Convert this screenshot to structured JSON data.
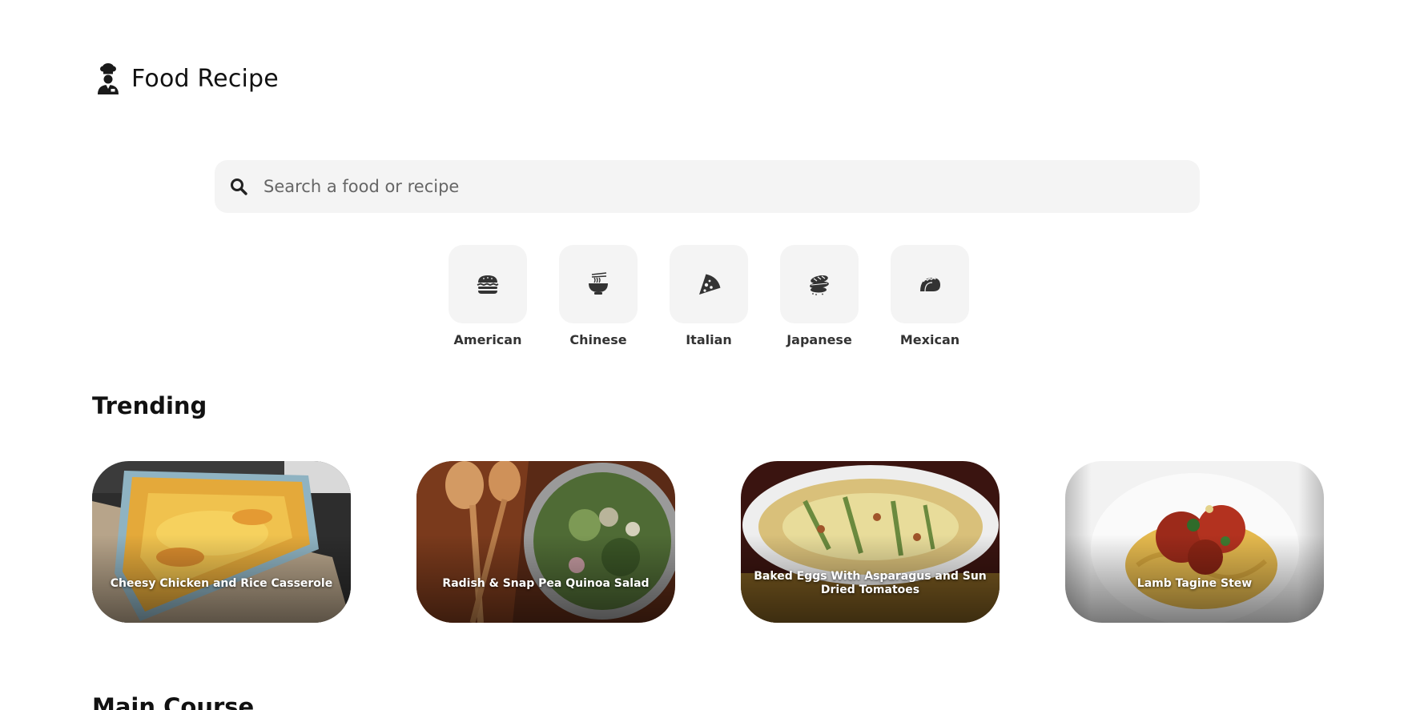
{
  "app": {
    "title": "Food Recipe",
    "logo_icon": "chef-icon"
  },
  "search": {
    "placeholder": "Search a food or recipe",
    "value": "",
    "icon": "search-icon"
  },
  "cuisines": [
    {
      "label": "American",
      "icon": "burger-icon"
    },
    {
      "label": "Chinese",
      "icon": "noodle-bowl-icon"
    },
    {
      "label": "Italian",
      "icon": "pizza-icon"
    },
    {
      "label": "Japanese",
      "icon": "sushi-icon"
    },
    {
      "label": "Mexican",
      "icon": "taco-icon"
    }
  ],
  "sections": {
    "trending": {
      "title": "Trending",
      "items": [
        {
          "title": "Cheesy Chicken and Rice Casserole"
        },
        {
          "title": "Radish & Snap Pea Quinoa Salad"
        },
        {
          "title": "Baked Eggs With Asparagus and Sun Dried Tomatoes"
        },
        {
          "title": "Lamb Tagine Stew"
        }
      ]
    },
    "main_course": {
      "title": "Main Course"
    }
  },
  "colors": {
    "tile_bg": "#f4f4f4",
    "text": "#111111",
    "label": "#333333",
    "card_text": "#ffffff"
  }
}
